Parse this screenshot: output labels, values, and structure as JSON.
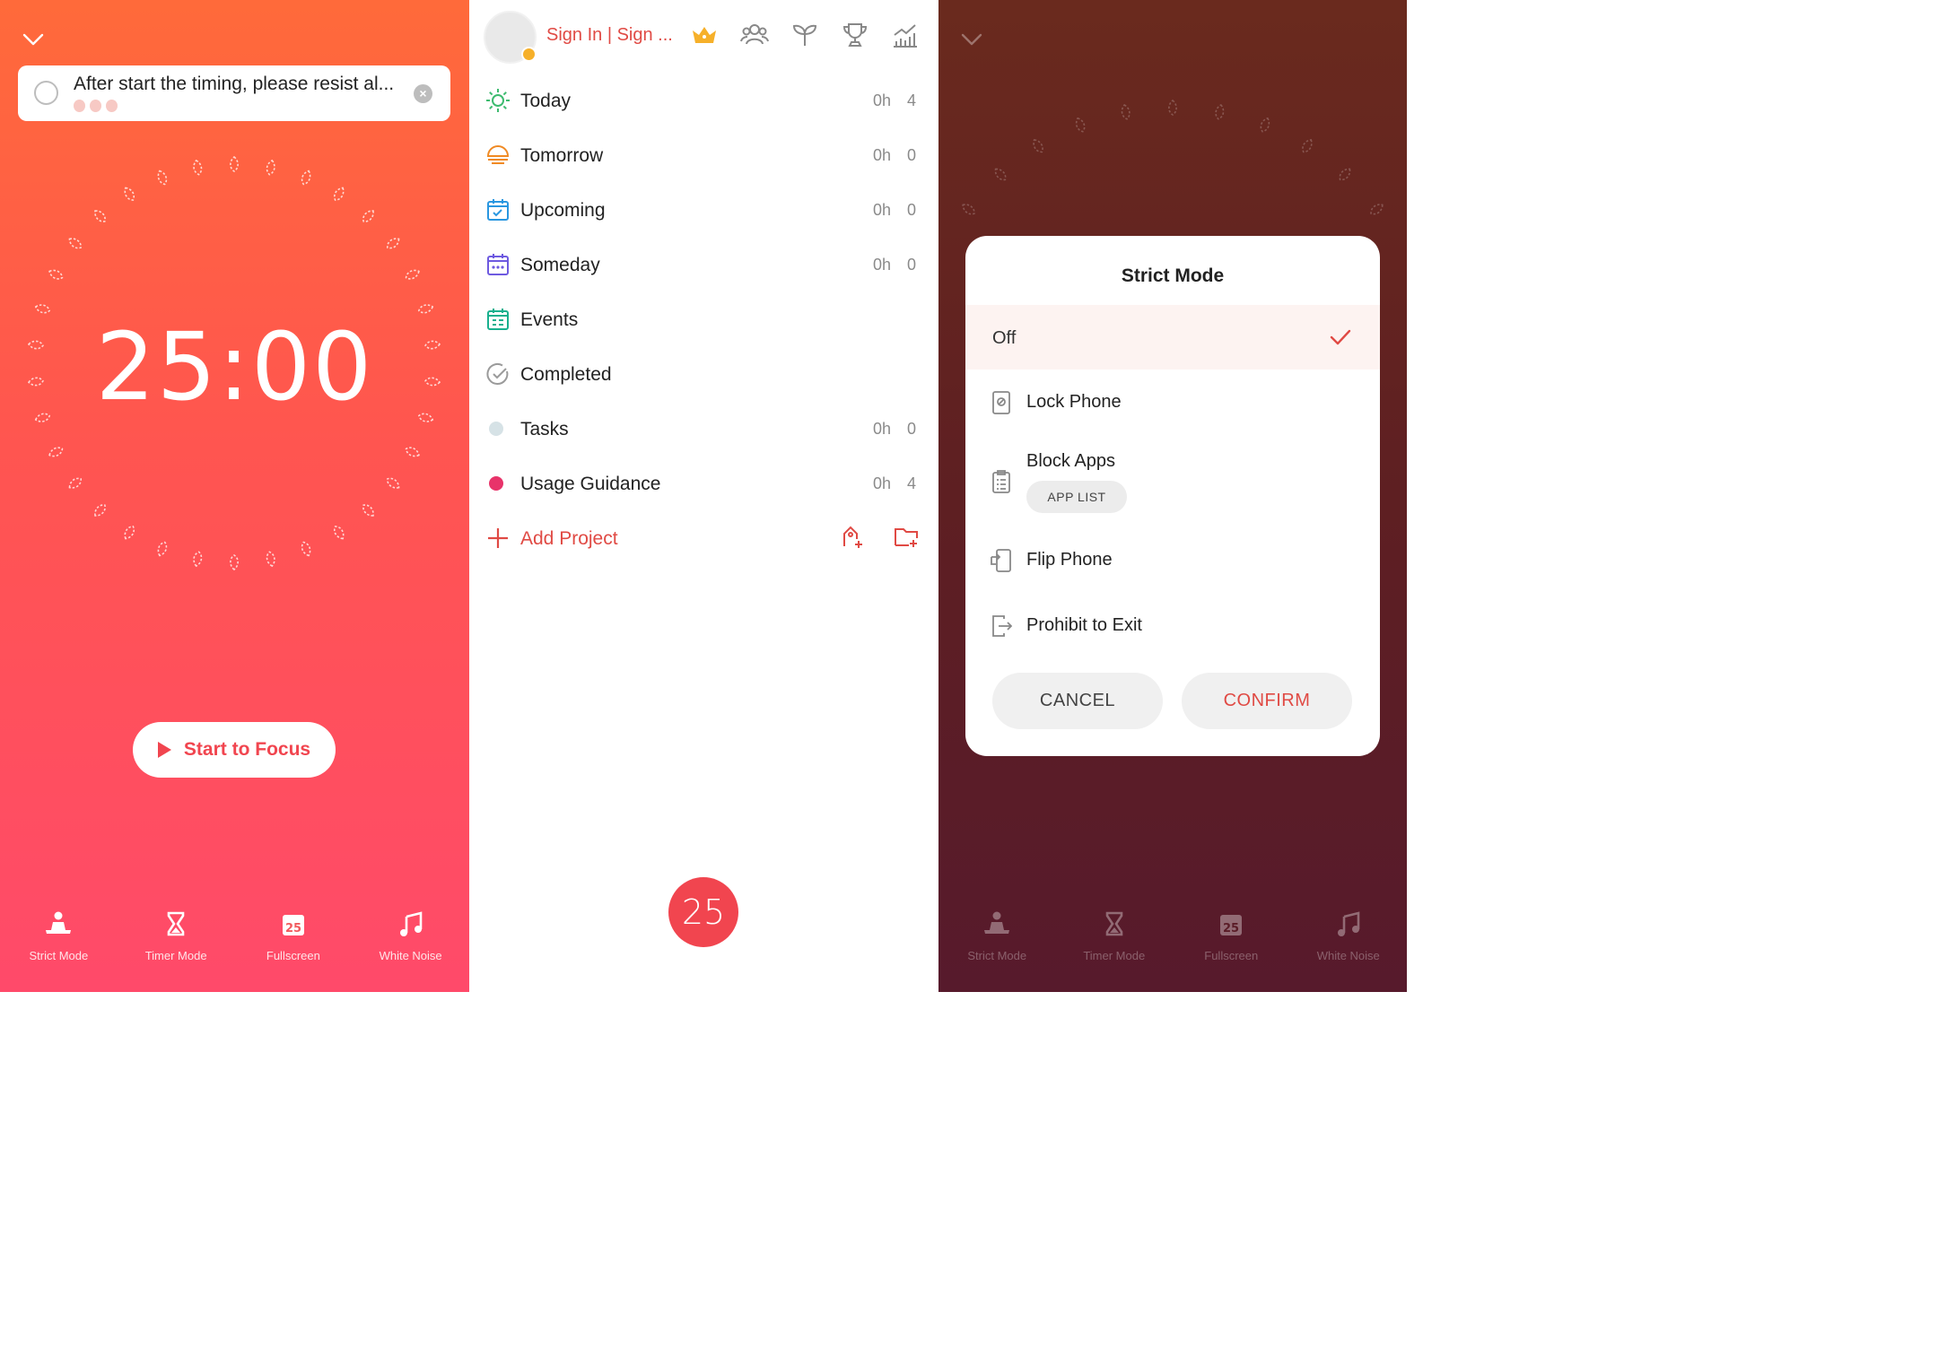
{
  "colors": {
    "accent": "#f1454f",
    "brand_red": "#e04a44",
    "panel1_top": "#ff6a3a",
    "panel1_bottom": "#ff4a6a",
    "panel3_bg": "#5e1f22"
  },
  "panel1": {
    "collapse_icon": "chevron-down-icon",
    "task": {
      "text": "After start the timing, please resist al...",
      "clear_icon": "close-icon"
    },
    "timer": "25:00",
    "start_button": "Start to Focus",
    "bottom_bar": [
      {
        "label": "Strict Mode",
        "icon": "meditation-icon"
      },
      {
        "label": "Timer Mode",
        "icon": "hourglass-icon"
      },
      {
        "label": "Fullscreen",
        "icon": "calendar-25-icon"
      },
      {
        "label": "White Noise",
        "icon": "music-note-icon"
      }
    ]
  },
  "panel2": {
    "signin": "Sign In | Sign ...",
    "top_icons": [
      "crown-icon",
      "group-icon",
      "sprout-icon",
      "trophy-icon",
      "stats-icon"
    ],
    "menu": [
      {
        "label": "Today",
        "time": "0h",
        "count": "4",
        "icon": "sun-icon",
        "color": "#3dbb6f"
      },
      {
        "label": "Tomorrow",
        "time": "0h",
        "count": "0",
        "icon": "sunset-icon",
        "color": "#f08a24"
      },
      {
        "label": "Upcoming",
        "time": "0h",
        "count": "0",
        "icon": "calendar-check-icon",
        "color": "#2a97e0"
      },
      {
        "label": "Someday",
        "time": "0h",
        "count": "0",
        "icon": "calendar-dots-icon",
        "color": "#6e5ae0"
      },
      {
        "label": "Events",
        "time": "",
        "count": "",
        "icon": "calendar-list-icon",
        "color": "#19b08e"
      },
      {
        "label": "Completed",
        "time": "",
        "count": "",
        "icon": "check-circle-icon",
        "color": "#9a9a9a"
      },
      {
        "label": "Tasks",
        "time": "0h",
        "count": "0",
        "icon": "dot-icon",
        "color": "#d6e2e6"
      },
      {
        "label": "Usage Guidance",
        "time": "0h",
        "count": "4",
        "icon": "dot-icon",
        "color": "#e8336a"
      }
    ],
    "add_project": "Add Project",
    "fab": "25"
  },
  "panel3": {
    "bottom_bar": [
      {
        "label": "Strict Mode"
      },
      {
        "label": "Timer Mode"
      },
      {
        "label": "Fullscreen"
      },
      {
        "label": "White Noise"
      }
    ],
    "modal": {
      "title": "Strict Mode",
      "options": [
        {
          "label": "Off",
          "selected": true
        },
        {
          "label": "Lock Phone",
          "icon": "lock-phone-icon"
        },
        {
          "label": "Block Apps",
          "icon": "clipboard-list-icon",
          "sub_button": "APP LIST"
        },
        {
          "label": "Flip Phone",
          "icon": "flip-phone-icon"
        },
        {
          "label": "Prohibit to Exit",
          "icon": "exit-icon"
        }
      ],
      "cancel": "CANCEL",
      "confirm": "CONFIRM"
    }
  }
}
